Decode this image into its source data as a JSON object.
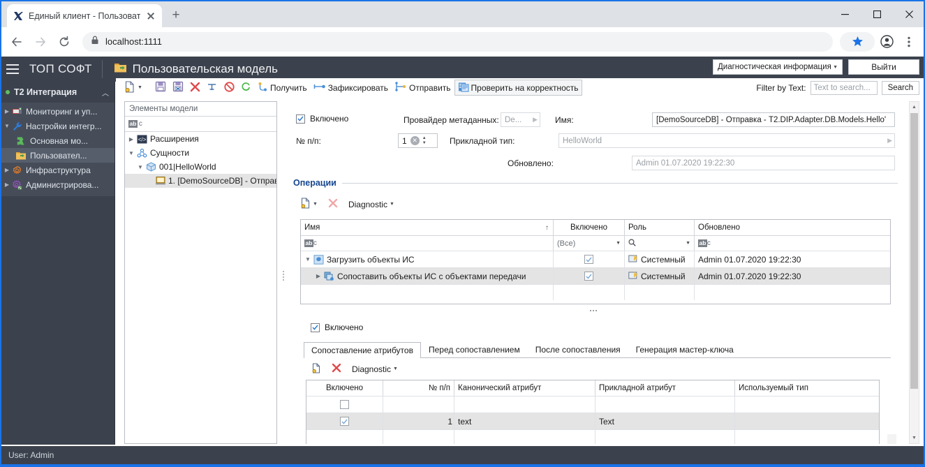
{
  "browser": {
    "tab_title": "Единый клиент - Пользователь",
    "new_tab_label": "+",
    "url": "localhost:1111",
    "back_icon": "back-arrow-icon",
    "forward_icon": "forward-arrow-icon",
    "reload_icon": "reload-icon",
    "lock_icon": "lock-icon",
    "star_icon": "star-icon",
    "profile_icon": "profile-icon",
    "menu_icon": "kebab-menu-icon",
    "minimize_label": "—",
    "maximize_label": "□",
    "close_label": "✕"
  },
  "header": {
    "brand": "ТОП СОФТ",
    "page_title": "Пользовательская модель",
    "page_icon": "folder-module-icon",
    "diagnostic_select": "Диагностическая информация",
    "exit_button": "Выйти"
  },
  "sidebar": {
    "group_label": "T2 Интеграция",
    "items": [
      {
        "label": "Мониторинг и уп...",
        "icon": "monitor-icon",
        "level": 1,
        "expandable": true,
        "selected": false
      },
      {
        "label": "Настройки интегр...",
        "icon": "wrench-icon",
        "level": 1,
        "expandable": true,
        "expanded": true,
        "selected": false
      },
      {
        "label": "Основная мо...",
        "icon": "puzzle-icon",
        "level": 2,
        "expandable": false,
        "selected": false
      },
      {
        "label": "Пользовател...",
        "icon": "folder-module-icon",
        "level": 2,
        "expandable": false,
        "selected": true
      },
      {
        "label": "Инфраструктура",
        "icon": "gear-orange-icon",
        "level": 1,
        "expandable": true,
        "selected": false
      },
      {
        "label": "Администрирова...",
        "icon": "gear-purple-icon",
        "level": 1,
        "expandable": true,
        "selected": false
      }
    ]
  },
  "toolbar": {
    "items": [
      {
        "label": "",
        "icon": "new-document-icon",
        "dropdown": true,
        "boxed": false
      },
      {
        "label": "",
        "icon": "save-icon",
        "dropdown": false,
        "boxed": false
      },
      {
        "label": "",
        "icon": "save-as-icon",
        "dropdown": false,
        "boxed": false
      },
      {
        "label": "",
        "icon": "delete-red-x-icon",
        "dropdown": false,
        "boxed": false
      },
      {
        "label": "",
        "icon": "cut-icon",
        "dropdown": false,
        "boxed": false
      },
      {
        "label": "",
        "icon": "block-icon",
        "dropdown": false,
        "boxed": false
      },
      {
        "label": "",
        "icon": "refresh-green-icon",
        "dropdown": false,
        "boxed": false
      },
      {
        "label": "Получить",
        "icon": "fetch-icon",
        "dropdown": false,
        "boxed": false
      },
      {
        "label": "Зафиксировать",
        "icon": "commit-icon",
        "dropdown": false,
        "boxed": false
      },
      {
        "label": "Отправить",
        "icon": "send-icon",
        "dropdown": false,
        "boxed": false
      },
      {
        "label": "Проверить на корректность",
        "icon": "validate-icon",
        "dropdown": false,
        "boxed": true
      }
    ],
    "filter_label": "Filter by Text:",
    "filter_placeholder": "Text to search...",
    "search_button": "Search"
  },
  "model_panel": {
    "header": "Элементы модели",
    "filter_badge": "abc",
    "tree": [
      {
        "label": "Расширения",
        "icon": "code-icon",
        "indent": 0,
        "arrow": "collapsed",
        "selected": false
      },
      {
        "label": "Сущности",
        "icon": "entities-icon",
        "indent": 0,
        "arrow": "expanded",
        "selected": false
      },
      {
        "label": "001|HelloWorld",
        "icon": "cube-icon",
        "indent": 1,
        "arrow": "expanded",
        "selected": false
      },
      {
        "label": "1. [DemoSourceDB] - Отправ",
        "icon": "adapter-icon",
        "indent": 2,
        "arrow": "none",
        "selected": true
      }
    ]
  },
  "form": {
    "enabled_label": "Включено",
    "enabled_checked": true,
    "metadata_provider_label": "Провайдер метаданных:",
    "metadata_provider_value": "De...",
    "name_label": "Имя:",
    "name_value": "[DemoSourceDB] - Отправка - T2.DIP.Adapter.DB.Models.Hello'",
    "seq_label": "№ п/п:",
    "seq_value": "1",
    "app_type_label": "Прикладной тип:",
    "app_type_value": "HelloWorld",
    "updated_label": "Обновлено:",
    "updated_value": "Admin 01.07.2020 19:22:30"
  },
  "operations": {
    "group_title": "Операции",
    "toolbar": [
      {
        "label": "",
        "icon": "new-document-icon",
        "dropdown": true
      },
      {
        "label": "",
        "icon": "delete-red-x-icon",
        "dropdown": false
      },
      {
        "label": "Diagnostic",
        "icon": "",
        "dropdown": true
      }
    ],
    "columns": [
      "Имя",
      "Включено",
      "Роль",
      "Обновлено"
    ],
    "filter_row": {
      "name": "abc",
      "enabled": "(Все)",
      "role": "",
      "updated": "abc"
    },
    "rows": [
      {
        "name": "Загрузить объекты ИС",
        "icon": "operation-gear-icon",
        "arrow": "expanded",
        "indent": 0,
        "enabled": true,
        "role": "Системный",
        "role_icon": "role-icon",
        "updated": "Admin 01.07.2020 19:22:30",
        "selected": false
      },
      {
        "name": "Сопоставить объекты ИС с объектами передачи",
        "icon": "mapping-icon",
        "arrow": "collapsed",
        "indent": 1,
        "enabled": true,
        "role": "Системный",
        "role_icon": "role-icon",
        "updated": "Admin 01.07.2020 19:22:30",
        "selected": true
      }
    ]
  },
  "detail": {
    "enabled_label": "Включено",
    "enabled_checked": true,
    "tabs": [
      {
        "label": "Сопоставление атрибутов",
        "active": true
      },
      {
        "label": "Перед сопоставлением",
        "active": false
      },
      {
        "label": "После сопоставления",
        "active": false
      },
      {
        "label": "Генерация мастер-ключа",
        "active": false
      }
    ],
    "toolbar": [
      {
        "label": "",
        "icon": "new-document-icon",
        "dropdown": false
      },
      {
        "label": "",
        "icon": "delete-red-x-icon",
        "dropdown": false
      },
      {
        "label": "Diagnostic",
        "icon": "",
        "dropdown": true
      }
    ],
    "columns": [
      "Включено",
      "№ п/п",
      "Канонический атрибут",
      "Прикладной атрибут",
      "Используемый тип"
    ],
    "rows": [
      {
        "enabled": null,
        "seq": "",
        "canonical": "",
        "applied": "",
        "type": "",
        "blank": true,
        "selected": false
      },
      {
        "enabled": true,
        "seq": "1",
        "canonical": "text",
        "applied": "Text",
        "type": "",
        "blank": false,
        "selected": true
      },
      {
        "enabled": null,
        "seq": "",
        "canonical": "",
        "applied": "",
        "type": "",
        "blank": true,
        "selected": false
      }
    ]
  },
  "statusbar": {
    "user_text": "User: Admin"
  },
  "colors": {
    "accent_blue": "#1a73e8",
    "dark_chrome": "#3c424d",
    "sidebar_list": "#464d59",
    "group_title": "#15458f",
    "selection_gray": "#e4e4e4",
    "checkbox_blue": "#2b7cd3",
    "red_x": "#e04a4a",
    "green": "#5fbf5f"
  }
}
